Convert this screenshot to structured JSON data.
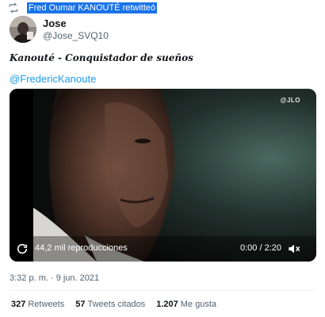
{
  "retweet": {
    "icon": "retweet-icon",
    "text": "Fred Oumar KANOUTÉ retwitteó"
  },
  "author": {
    "name": "Jose",
    "handle": "@Jose_SVQ10"
  },
  "tweet": {
    "text": "Kanouté - Conquistador de sueños",
    "mention": "@FredericKanoute"
  },
  "video": {
    "watermark": "@JLO",
    "views": "44,2 mil reproducciones",
    "time": "0:00 / 2:20",
    "play_icon": "play-icon",
    "volume_icon": "volume-icon"
  },
  "timestamp": "3:32 p. m. · 9 jun. 2021",
  "stats": {
    "retweets_count": "327",
    "retweets_label": "Retweets",
    "quotes_count": "57",
    "quotes_label": "Tweets citados",
    "likes_count": "1.207",
    "likes_label": "Me gusta"
  },
  "colors": {
    "link": "#1d9bf0",
    "secondary_text": "#536471",
    "selection": "#1a73e8"
  }
}
